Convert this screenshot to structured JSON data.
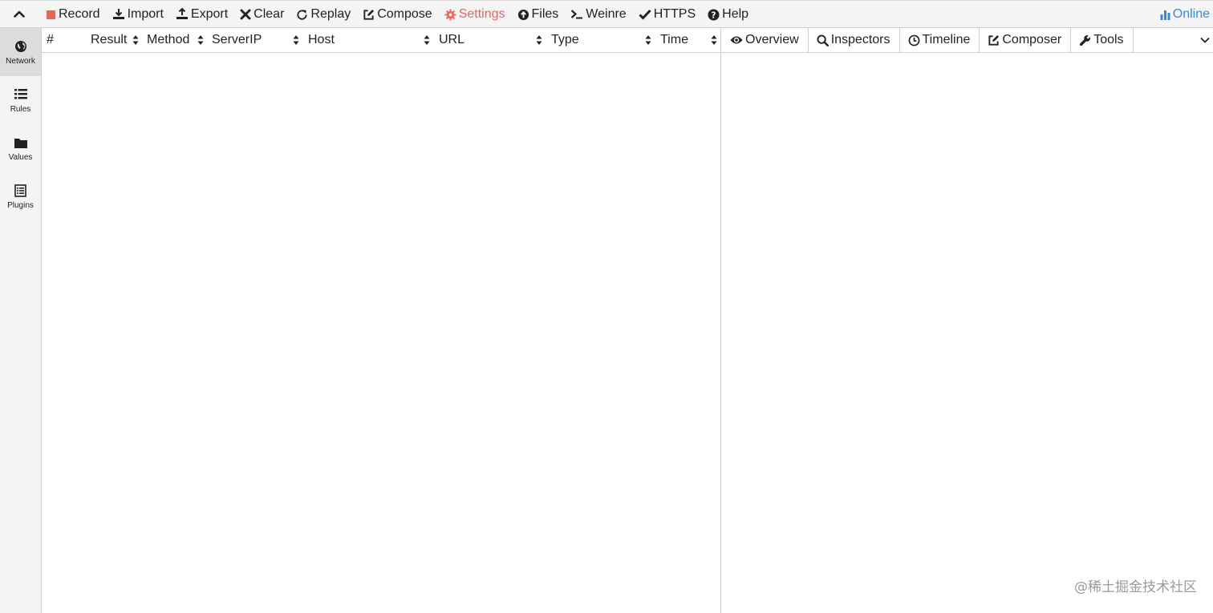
{
  "toolbar": {
    "items": [
      {
        "key": "record",
        "label": "Record",
        "icon": "stop-square-icon",
        "color": "#e7665c"
      },
      {
        "key": "import",
        "label": "Import",
        "icon": "import-icon"
      },
      {
        "key": "export",
        "label": "Export",
        "icon": "export-icon"
      },
      {
        "key": "clear",
        "label": "Clear",
        "icon": "close-icon"
      },
      {
        "key": "replay",
        "label": "Replay",
        "icon": "refresh-icon"
      },
      {
        "key": "compose",
        "label": "Compose",
        "icon": "edit-icon"
      },
      {
        "key": "settings",
        "label": "Settings",
        "icon": "gear-icon",
        "active": true,
        "color": "#e7665c"
      },
      {
        "key": "files",
        "label": "Files",
        "icon": "upload-circle-icon"
      },
      {
        "key": "weinre",
        "label": "Weinre",
        "icon": "terminal-icon"
      },
      {
        "key": "https",
        "label": "HTTPS",
        "icon": "check-icon"
      },
      {
        "key": "help",
        "label": "Help",
        "icon": "question-circle-icon"
      }
    ],
    "online": {
      "label": "Online",
      "icon": "bar-chart-icon",
      "color": "#3b87d6"
    }
  },
  "sidebar": {
    "items": [
      {
        "key": "network",
        "label": "Network",
        "icon": "globe-icon",
        "active": true
      },
      {
        "key": "rules",
        "label": "Rules",
        "icon": "list-icon"
      },
      {
        "key": "values",
        "label": "Values",
        "icon": "folder-icon"
      },
      {
        "key": "plugins",
        "label": "Plugins",
        "icon": "document-list-icon"
      }
    ]
  },
  "list": {
    "columns": [
      {
        "key": "index",
        "label": "#"
      },
      {
        "key": "result",
        "label": "Result"
      },
      {
        "key": "method",
        "label": "Method"
      },
      {
        "key": "serverip",
        "label": "ServerIP"
      },
      {
        "key": "host",
        "label": "Host"
      },
      {
        "key": "url",
        "label": "URL"
      },
      {
        "key": "type",
        "label": "Type"
      },
      {
        "key": "time",
        "label": "Time"
      }
    ],
    "rows": []
  },
  "detail": {
    "tabs": [
      {
        "key": "overview",
        "label": "Overview",
        "icon": "eye-icon"
      },
      {
        "key": "inspectors",
        "label": "Inspectors",
        "icon": "search-icon"
      },
      {
        "key": "timeline",
        "label": "Timeline",
        "icon": "clock-icon"
      },
      {
        "key": "composer",
        "label": "Composer",
        "icon": "edit-icon"
      },
      {
        "key": "tools",
        "label": "Tools",
        "icon": "wrench-icon"
      }
    ]
  },
  "watermark": "@稀土掘金技术社区"
}
